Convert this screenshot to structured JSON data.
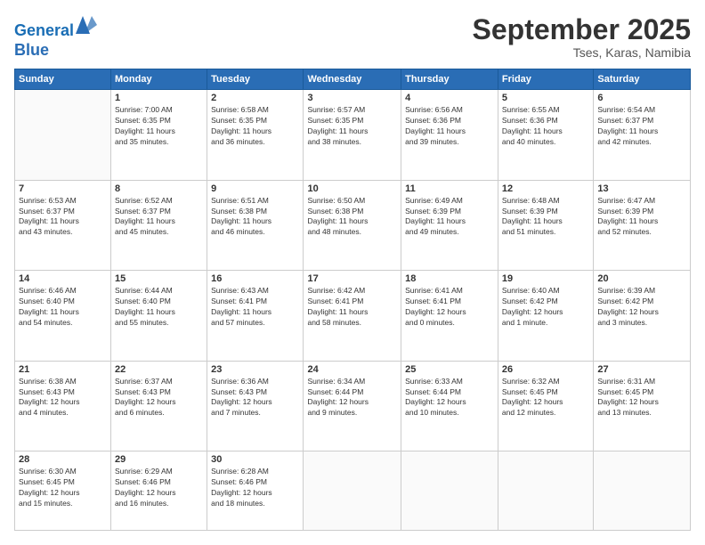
{
  "logo": {
    "line1": "General",
    "line2": "Blue"
  },
  "header": {
    "month": "September 2025",
    "location": "Tses, Karas, Namibia"
  },
  "weekdays": [
    "Sunday",
    "Monday",
    "Tuesday",
    "Wednesday",
    "Thursday",
    "Friday",
    "Saturday"
  ],
  "weeks": [
    [
      {
        "day": "",
        "info": ""
      },
      {
        "day": "1",
        "info": "Sunrise: 7:00 AM\nSunset: 6:35 PM\nDaylight: 11 hours\nand 35 minutes."
      },
      {
        "day": "2",
        "info": "Sunrise: 6:58 AM\nSunset: 6:35 PM\nDaylight: 11 hours\nand 36 minutes."
      },
      {
        "day": "3",
        "info": "Sunrise: 6:57 AM\nSunset: 6:35 PM\nDaylight: 11 hours\nand 38 minutes."
      },
      {
        "day": "4",
        "info": "Sunrise: 6:56 AM\nSunset: 6:36 PM\nDaylight: 11 hours\nand 39 minutes."
      },
      {
        "day": "5",
        "info": "Sunrise: 6:55 AM\nSunset: 6:36 PM\nDaylight: 11 hours\nand 40 minutes."
      },
      {
        "day": "6",
        "info": "Sunrise: 6:54 AM\nSunset: 6:37 PM\nDaylight: 11 hours\nand 42 minutes."
      }
    ],
    [
      {
        "day": "7",
        "info": "Sunrise: 6:53 AM\nSunset: 6:37 PM\nDaylight: 11 hours\nand 43 minutes."
      },
      {
        "day": "8",
        "info": "Sunrise: 6:52 AM\nSunset: 6:37 PM\nDaylight: 11 hours\nand 45 minutes."
      },
      {
        "day": "9",
        "info": "Sunrise: 6:51 AM\nSunset: 6:38 PM\nDaylight: 11 hours\nand 46 minutes."
      },
      {
        "day": "10",
        "info": "Sunrise: 6:50 AM\nSunset: 6:38 PM\nDaylight: 11 hours\nand 48 minutes."
      },
      {
        "day": "11",
        "info": "Sunrise: 6:49 AM\nSunset: 6:39 PM\nDaylight: 11 hours\nand 49 minutes."
      },
      {
        "day": "12",
        "info": "Sunrise: 6:48 AM\nSunset: 6:39 PM\nDaylight: 11 hours\nand 51 minutes."
      },
      {
        "day": "13",
        "info": "Sunrise: 6:47 AM\nSunset: 6:39 PM\nDaylight: 11 hours\nand 52 minutes."
      }
    ],
    [
      {
        "day": "14",
        "info": "Sunrise: 6:46 AM\nSunset: 6:40 PM\nDaylight: 11 hours\nand 54 minutes."
      },
      {
        "day": "15",
        "info": "Sunrise: 6:44 AM\nSunset: 6:40 PM\nDaylight: 11 hours\nand 55 minutes."
      },
      {
        "day": "16",
        "info": "Sunrise: 6:43 AM\nSunset: 6:41 PM\nDaylight: 11 hours\nand 57 minutes."
      },
      {
        "day": "17",
        "info": "Sunrise: 6:42 AM\nSunset: 6:41 PM\nDaylight: 11 hours\nand 58 minutes."
      },
      {
        "day": "18",
        "info": "Sunrise: 6:41 AM\nSunset: 6:41 PM\nDaylight: 12 hours\nand 0 minutes."
      },
      {
        "day": "19",
        "info": "Sunrise: 6:40 AM\nSunset: 6:42 PM\nDaylight: 12 hours\nand 1 minute."
      },
      {
        "day": "20",
        "info": "Sunrise: 6:39 AM\nSunset: 6:42 PM\nDaylight: 12 hours\nand 3 minutes."
      }
    ],
    [
      {
        "day": "21",
        "info": "Sunrise: 6:38 AM\nSunset: 6:43 PM\nDaylight: 12 hours\nand 4 minutes."
      },
      {
        "day": "22",
        "info": "Sunrise: 6:37 AM\nSunset: 6:43 PM\nDaylight: 12 hours\nand 6 minutes."
      },
      {
        "day": "23",
        "info": "Sunrise: 6:36 AM\nSunset: 6:43 PM\nDaylight: 12 hours\nand 7 minutes."
      },
      {
        "day": "24",
        "info": "Sunrise: 6:34 AM\nSunset: 6:44 PM\nDaylight: 12 hours\nand 9 minutes."
      },
      {
        "day": "25",
        "info": "Sunrise: 6:33 AM\nSunset: 6:44 PM\nDaylight: 12 hours\nand 10 minutes."
      },
      {
        "day": "26",
        "info": "Sunrise: 6:32 AM\nSunset: 6:45 PM\nDaylight: 12 hours\nand 12 minutes."
      },
      {
        "day": "27",
        "info": "Sunrise: 6:31 AM\nSunset: 6:45 PM\nDaylight: 12 hours\nand 13 minutes."
      }
    ],
    [
      {
        "day": "28",
        "info": "Sunrise: 6:30 AM\nSunset: 6:45 PM\nDaylight: 12 hours\nand 15 minutes."
      },
      {
        "day": "29",
        "info": "Sunrise: 6:29 AM\nSunset: 6:46 PM\nDaylight: 12 hours\nand 16 minutes."
      },
      {
        "day": "30",
        "info": "Sunrise: 6:28 AM\nSunset: 6:46 PM\nDaylight: 12 hours\nand 18 minutes."
      },
      {
        "day": "",
        "info": ""
      },
      {
        "day": "",
        "info": ""
      },
      {
        "day": "",
        "info": ""
      },
      {
        "day": "",
        "info": ""
      }
    ]
  ]
}
